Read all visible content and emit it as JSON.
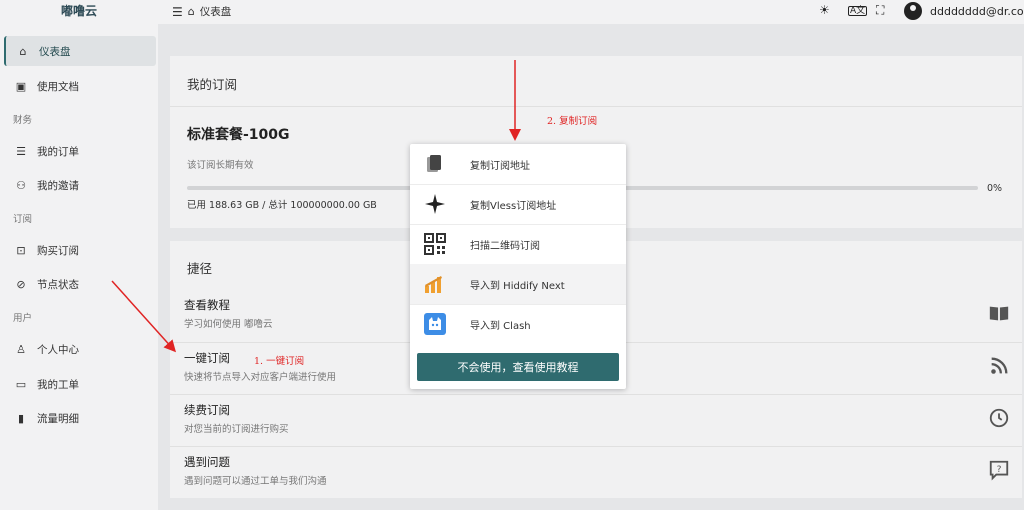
{
  "sidebar": {
    "brand": "嘟噜云",
    "items": [
      {
        "label": "仪表盘",
        "icon": "home-icon"
      },
      {
        "label": "使用文档",
        "icon": "book-icon"
      },
      {
        "label": "我的订单",
        "icon": "list-icon"
      },
      {
        "label": "我的邀请",
        "icon": "users-icon"
      },
      {
        "label": "购买订阅",
        "icon": "bag-icon"
      },
      {
        "label": "节点状态",
        "icon": "check-circle-icon"
      },
      {
        "label": "个人中心",
        "icon": "user-icon"
      },
      {
        "label": "我的工单",
        "icon": "ticket-icon"
      },
      {
        "label": "流量明细",
        "icon": "bars-icon"
      }
    ],
    "sections": [
      "财务",
      "订阅",
      "用户"
    ]
  },
  "topbar": {
    "breadcrumb": "仪表盘",
    "user_email": "dddddddd@dr.com"
  },
  "subscription": {
    "card_title": "我的订阅",
    "plan_name": "标准套餐-100G",
    "validity": "该订阅长期有效",
    "progress_percent": 0,
    "progress_label": "0%",
    "usage": "已用 188.63 GB / 总计 100000000.00 GB"
  },
  "shortcuts": {
    "title": "捷径",
    "items": [
      {
        "title": "查看教程",
        "desc": "学习如何使用 嘟噜云",
        "icon": "book-open-icon"
      },
      {
        "title": "一键订阅",
        "desc": "快速将节点导入对应客户端进行使用",
        "icon": "rss-icon"
      },
      {
        "title": "续费订阅",
        "desc": "对您当前的订阅进行购买",
        "icon": "clock-icon"
      },
      {
        "title": "遇到问题",
        "desc": "遇到问题可以通过工单与我们沟通",
        "icon": "help-chat-icon"
      }
    ]
  },
  "popup": {
    "items": [
      {
        "label": "复制订阅地址",
        "icon": "copy-icon"
      },
      {
        "label": "复制Vless订阅地址",
        "icon": "sparkle-icon"
      },
      {
        "label": "扫描二维码订阅",
        "icon": "qr-code-icon"
      },
      {
        "label": "导入到 Hiddify Next",
        "icon": "hiddify-icon"
      },
      {
        "label": "导入到 Clash",
        "icon": "clash-icon"
      }
    ],
    "help_button": "不会使用，查看使用教程"
  },
  "annotations": {
    "step1": "1. 一键订阅",
    "step2": "2. 复制订阅",
    "color": "#e02424"
  },
  "colors": {
    "accent": "#2f6b6f",
    "hiddify": "#f0a030",
    "clash": "#3d8de6"
  }
}
